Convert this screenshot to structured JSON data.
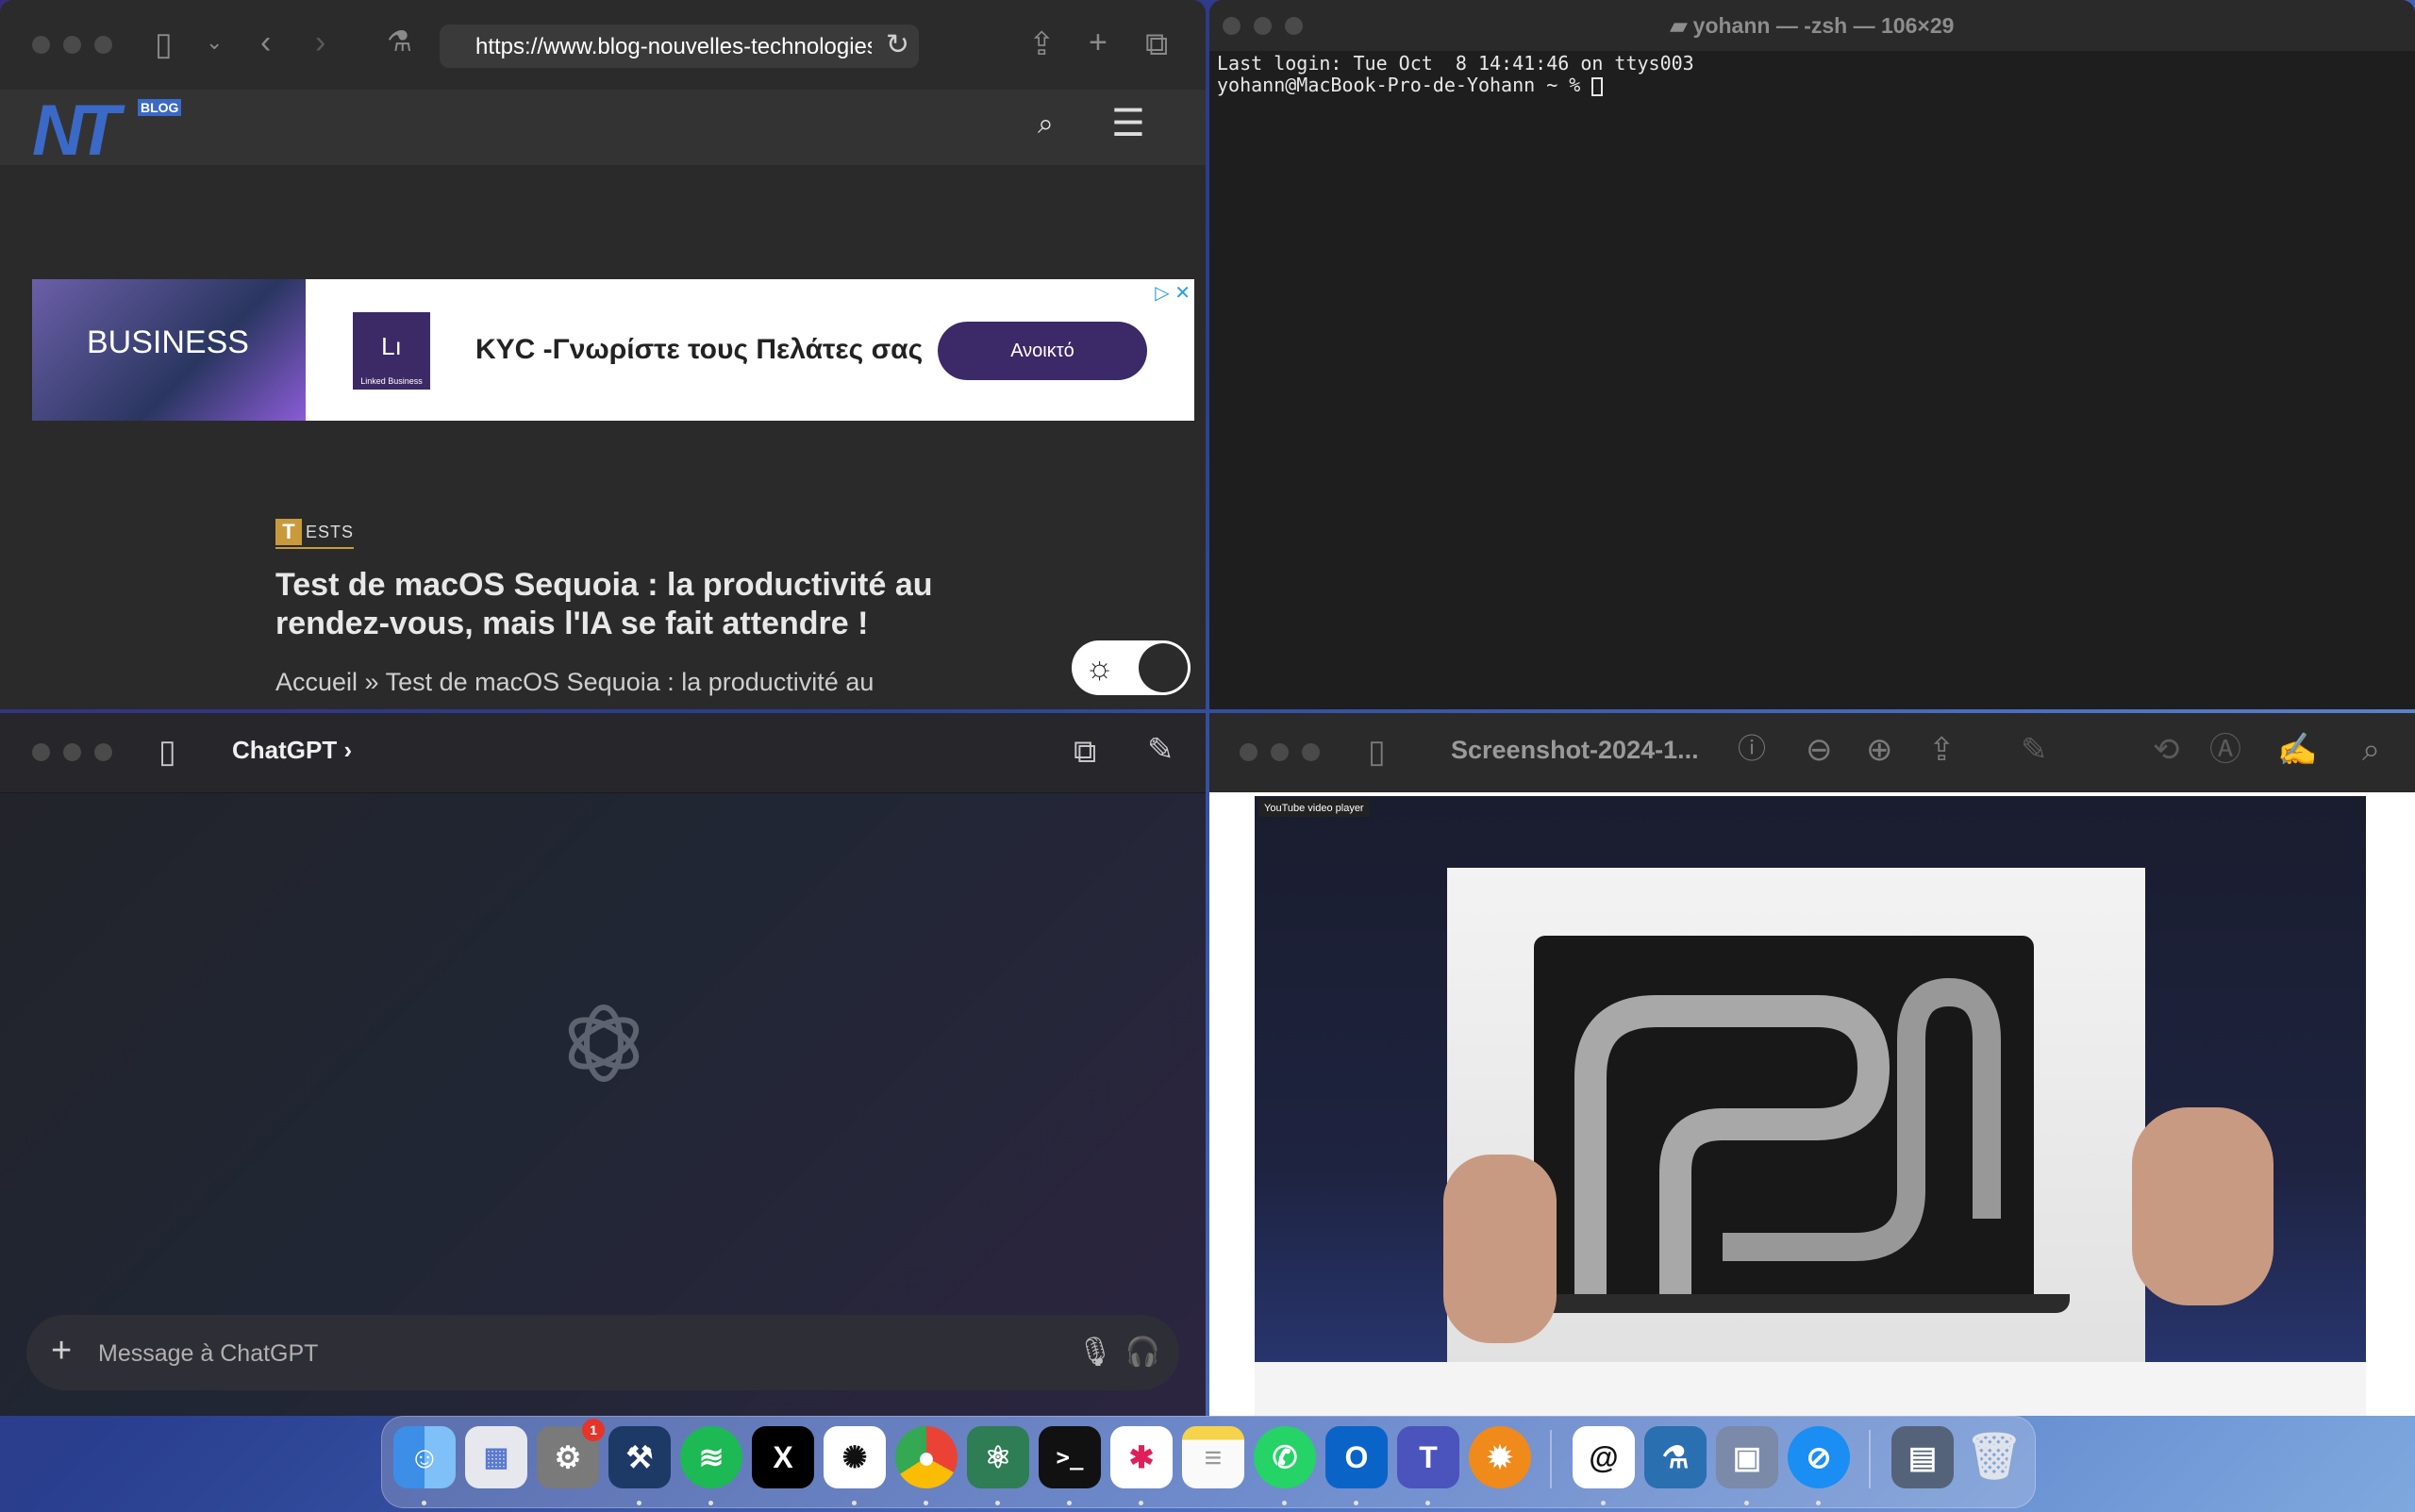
{
  "safari": {
    "url": "https://www.blog-nouvelles-technologies.fr/",
    "logo_text": "NT",
    "logo_badge": "BLOG",
    "ad": {
      "image_text": "BUSINESS",
      "logo_text": "Lı",
      "logo_caption": "Linked Business",
      "headline": "KYC -Γνωρίστε τους Πελάτες σας",
      "cta": "Ανοικτό"
    },
    "category_initial": "T",
    "category_rest": "ESTS",
    "article_title": "Test de macOS Sequoia : la productivité au rendez-vous, mais l'IA se fait attendre !",
    "breadcrumb": "Accueil » Test de macOS Sequoia : la productivité au"
  },
  "terminal": {
    "title": "yohann — -zsh — 106×29",
    "line1": "Last login: Tue Oct  8 14:41:46 on ttys003",
    "line2": "yohann@MacBook-Pro-de-Yohann ~ % "
  },
  "chatgpt": {
    "title": "ChatGPT",
    "chevron": "›",
    "placeholder": "Message à ChatGPT"
  },
  "preview": {
    "title": "Screenshot-2024-1...",
    "video_label": "YouTube video player"
  },
  "dock": {
    "finder": "Finder",
    "launchpad": "Launchpad",
    "settings": "System Settings",
    "settings_badge": "1",
    "xcode": "Xcode",
    "spotify": "Spotify",
    "x": "X",
    "chatgpt": "ChatGPT",
    "chrome": "Chrome",
    "atom": "Atom",
    "terminal": "Terminal",
    "slack": "Slack",
    "notes": "Notes",
    "whatsapp": "WhatsApp",
    "outlook": "Outlook",
    "teams": "Teams",
    "vlc": "VLC",
    "threads": "Threads",
    "xcode_labs": "Instruments",
    "preview": "Preview",
    "safari": "Safari",
    "screenshot": "Screenshot",
    "trash": "Trash"
  }
}
